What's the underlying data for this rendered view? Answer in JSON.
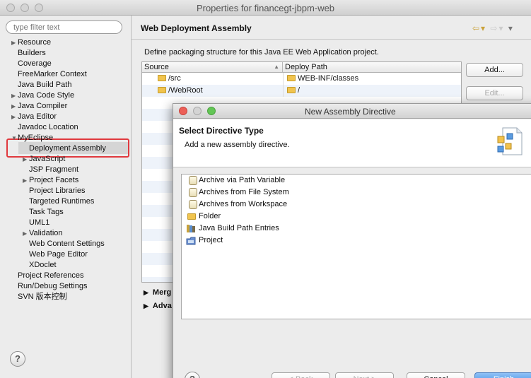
{
  "window": {
    "title": "Properties for financegt-jbpm-web"
  },
  "filter": {
    "placeholder": "type filter text"
  },
  "tree": [
    {
      "label": "Resource",
      "arrow": true
    },
    {
      "label": "Builders"
    },
    {
      "label": "Coverage"
    },
    {
      "label": "FreeMarker Context"
    },
    {
      "label": "Java Build Path"
    },
    {
      "label": "Java Code Style",
      "arrow": true
    },
    {
      "label": "Java Compiler",
      "arrow": true
    },
    {
      "label": "Java Editor",
      "arrow": true
    },
    {
      "label": "Javadoc Location"
    },
    {
      "label": "MyEclipse",
      "arrow": true,
      "expanded": true
    },
    {
      "label": "Deployment Assembly",
      "selected": true
    },
    {
      "label": "JavaScript",
      "arrow": true
    },
    {
      "label": "JSP Fragment"
    },
    {
      "label": "Project Facets",
      "arrow": true
    },
    {
      "label": "Project Libraries"
    },
    {
      "label": "Targeted Runtimes"
    },
    {
      "label": "Task Tags"
    },
    {
      "label": "UML1"
    },
    {
      "label": "Validation",
      "arrow": true
    },
    {
      "label": "Web Content Settings"
    },
    {
      "label": "Web Page Editor"
    },
    {
      "label": "XDoclet"
    },
    {
      "label": "Project References"
    },
    {
      "label": "Run/Debug Settings"
    },
    {
      "label": "SVN 版本控制"
    }
  ],
  "page": {
    "title": "Web Deployment Assembly",
    "description": "Define packaging structure for this Java EE Web Application project.",
    "columns": {
      "source": "Source",
      "deploy": "Deploy Path"
    },
    "rows": [
      {
        "source": "/src",
        "deploy": "WEB-INF/classes"
      },
      {
        "source": "/WebRoot",
        "deploy": "/"
      }
    ],
    "add_label": "Add...",
    "edit_label": "Edit...",
    "sections": [
      "Merg",
      "Adva"
    ]
  },
  "help_label": "?",
  "dialog": {
    "title": "New Assembly Directive",
    "heading": "Select Directive Type",
    "subheading": "Add a new assembly directive.",
    "items": [
      {
        "label": "Archive via Path Variable",
        "icon": "jar-icon"
      },
      {
        "label": "Archives from File System",
        "icon": "jar-icon"
      },
      {
        "label": "Archives from Workspace",
        "icon": "jar-icon"
      },
      {
        "label": "Folder",
        "icon": "folder-icon"
      },
      {
        "label": "Java Build Path Entries",
        "icon": "library-icon"
      },
      {
        "label": "Project",
        "icon": "project-icon"
      }
    ],
    "buttons": {
      "back": "< Back",
      "next": "Next >",
      "cancel": "Cancel",
      "finish": "Finish"
    }
  },
  "colors": {
    "highlight": "#e0393e",
    "accent": "#3d8fe6"
  }
}
